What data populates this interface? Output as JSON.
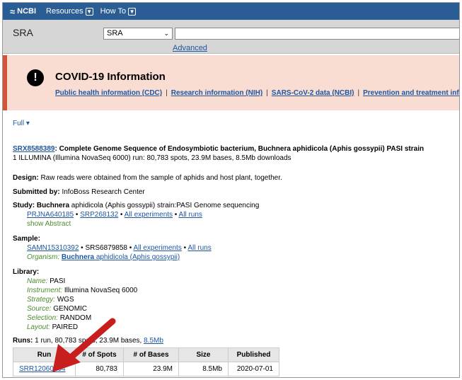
{
  "header": {
    "logo": "NCBI",
    "menus": [
      {
        "label": "Resources"
      },
      {
        "label": "How To"
      }
    ]
  },
  "search": {
    "db_title": "SRA",
    "db_selected": "SRA",
    "advanced": "Advanced"
  },
  "covid": {
    "title": "COVID-19 Information",
    "links": [
      "Public health information (CDC)",
      "Research information (NIH)",
      "SARS-CoV-2 data (NCBI)",
      "Prevention and treatment infor"
    ]
  },
  "record": {
    "format": "Full",
    "accession": "SRX8588389",
    "title_rest": ": Complete Genome Sequence of Endosymbiotic bacterium, Buchnera aphidicola (Aphis gossypii) PASI strain",
    "summary": "1 ILLUMINA (Illumina NovaSeq 6000) run: 80,783 spots, 23.9M bases, 8.5Mb downloads",
    "design_label": "Design:",
    "design": "Raw reads were obtained from the sample of aphids and host plant, together.",
    "submitted_label": "Submitted by:",
    "submitted": "InfoBoss Research Center",
    "study_label": "Study:",
    "study_strong": "Buchnera",
    "study_rest": "aphidicola (Aphis gossypii) strain:PASI Genome sequencing",
    "study_links": {
      "bioproject": "PRJNA640185",
      "srp": "SRP268132",
      "all_experiments": "All experiments",
      "all_runs": "All runs"
    },
    "show_abstract": "show Abstract",
    "sample_label": "Sample:",
    "sample_links": {
      "biosample": "SAMN15310392",
      "srs": "SRS6879858",
      "all_experiments": "All experiments",
      "all_runs": "All runs"
    },
    "organism_label": "Organism:",
    "organism_strong": "Buchnera",
    "organism_rest": "aphidicola (Aphis gossypii)",
    "library_label": "Library:",
    "library": [
      {
        "label": "Name:",
        "value": "PASI"
      },
      {
        "label": "Instrument:",
        "value": "Illumina NovaSeq 6000"
      },
      {
        "label": "Strategy:",
        "value": "WGS"
      },
      {
        "label": "Source:",
        "value": "GENOMIC"
      },
      {
        "label": "Selection:",
        "value": "RANDOM"
      },
      {
        "label": "Layout:",
        "value": "PAIRED"
      }
    ],
    "runs_label": "Runs:",
    "runs_summary_pre": "1 run, 80,783 spots, 23.9M bases,",
    "runs_summary_link": "8.5Mb"
  },
  "runs_table": {
    "columns": [
      "Run",
      "# of Spots",
      "# of Bases",
      "Size",
      "Published"
    ],
    "rows": [
      [
        "SRR12060204",
        "80,783",
        "23.9M",
        "8.5Mb",
        "2020-07-01"
      ]
    ]
  },
  "colors": {
    "ncbi_blue": "#2a5d94",
    "alert_red": "#d2553a",
    "arrow_red": "#c81e1e",
    "link": "#1e56a0"
  }
}
